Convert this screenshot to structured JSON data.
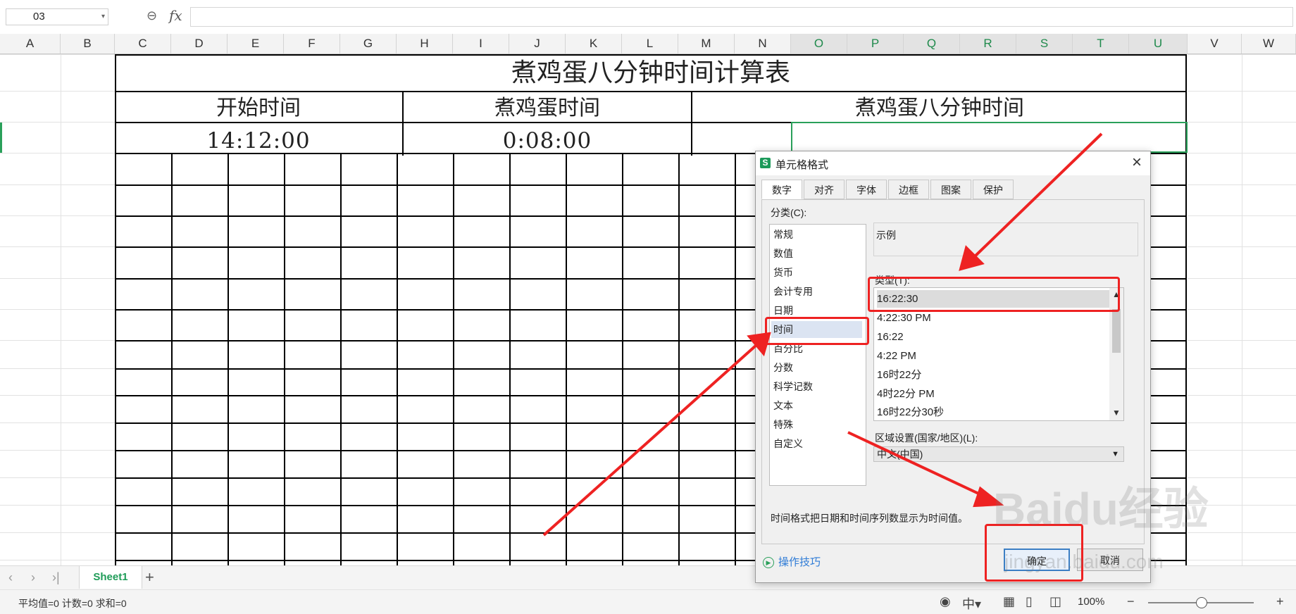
{
  "formula_bar": {
    "name_box": "03",
    "fx_label": "fx",
    "formula": ""
  },
  "columns": [
    "A",
    "B",
    "C",
    "D",
    "E",
    "F",
    "G",
    "H",
    "I",
    "J",
    "K",
    "L",
    "M",
    "N",
    "O",
    "P",
    "Q",
    "R",
    "S",
    "T",
    "U",
    "V",
    "W"
  ],
  "table": {
    "title": "煮鸡蛋八分钟时间计算表",
    "headers": [
      "开始时间",
      "煮鸡蛋时间",
      "煮鸡蛋八分钟时间"
    ],
    "values": [
      "14:12:00",
      "0:08:00",
      ""
    ]
  },
  "sheet_bar": {
    "active_sheet": "Sheet1",
    "add_label": "+"
  },
  "status_bar": {
    "summary": "平均值=0  计数=0  求和=0",
    "zoom": "100%",
    "zoom_percent": 100
  },
  "dialog": {
    "title": "单元格格式",
    "close": "×",
    "tabs": [
      "数字",
      "对齐",
      "字体",
      "边框",
      "图案",
      "保护"
    ],
    "active_tab": "数字",
    "category_label": "分类(C):",
    "categories": [
      "常规",
      "数值",
      "货币",
      "会计专用",
      "日期",
      "时间",
      "百分比",
      "分数",
      "科学记数",
      "文本",
      "特殊",
      "自定义"
    ],
    "selected_category": "时间",
    "sample_label": "示例",
    "type_label": "类型(T):",
    "types": [
      "16:22:30",
      "4:22:30 PM",
      "16:22",
      "4:22 PM",
      "16时22分",
      "4时22分 PM",
      "16时22分30秒"
    ],
    "selected_type": "16:22:30",
    "locale_label": "区域设置(国家/地区)(L):",
    "locale_value": "中文(中国)",
    "description": "时间格式把日期和时间序列数显示为时间值。",
    "tips": "操作技巧",
    "ok": "确定",
    "cancel": "取消"
  },
  "watermark": {
    "brand": "Baidu经验",
    "url": "jingyan.baidu.com"
  },
  "colors": {
    "accent_green": "#1f9c58",
    "annotation_red": "#ee2222",
    "ok_border": "#3c7fc4"
  }
}
